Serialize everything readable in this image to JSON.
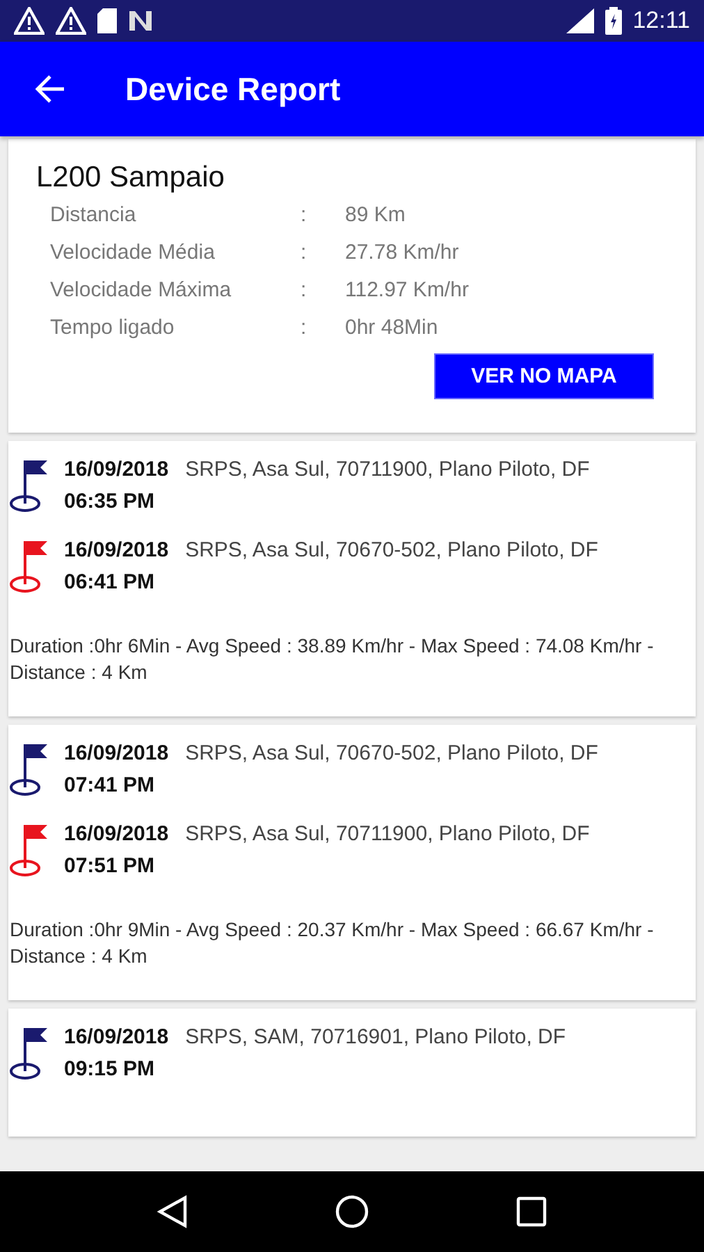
{
  "status_bar": {
    "time": "12:11"
  },
  "app_bar": {
    "title": "Device Report"
  },
  "summary": {
    "device": "L200 Sampaio",
    "rows": [
      {
        "label": "Distancia",
        "separator": ":",
        "value": "89 Km"
      },
      {
        "label": "Velocidade Média",
        "separator": ":",
        "value": "27.78 Km/hr"
      },
      {
        "label": "Velocidade Máxima",
        "separator": ":",
        "value": "112.97 Km/hr"
      },
      {
        "label": "Tempo ligado",
        "separator": ":",
        "value": "0hr 48Min"
      }
    ],
    "button": "VER NO MAPA"
  },
  "trips": [
    {
      "points": [
        {
          "kind": "start",
          "date": "16/09/2018",
          "address": "SRPS, Asa Sul, 70711900, Plano Piloto, DF",
          "time": "06:35 PM"
        },
        {
          "kind": "end",
          "date": "16/09/2018",
          "address": "SRPS, Asa Sul, 70670-502, Plano Piloto, DF",
          "time": "06:41 PM"
        }
      ],
      "summary": "Duration :0hr 6Min - Avg Speed : 38.89 Km/hr - Max Speed : 74.08 Km/hr - Distance : 4 Km"
    },
    {
      "points": [
        {
          "kind": "start",
          "date": "16/09/2018",
          "address": "SRPS, Asa Sul, 70670-502, Plano Piloto, DF",
          "time": "07:41 PM"
        },
        {
          "kind": "end",
          "date": "16/09/2018",
          "address": "SRPS, Asa Sul, 70711900, Plano Piloto, DF",
          "time": "07:51 PM"
        }
      ],
      "summary": "Duration :0hr 9Min - Avg Speed : 20.37 Km/hr - Max Speed : 66.67 Km/hr - Distance : 4 Km"
    },
    {
      "points": [
        {
          "kind": "start",
          "date": "16/09/2018",
          "address": "SRPS, SAM, 70716901, Plano Piloto, DF",
          "time": "09:15 PM"
        }
      ]
    }
  ]
}
